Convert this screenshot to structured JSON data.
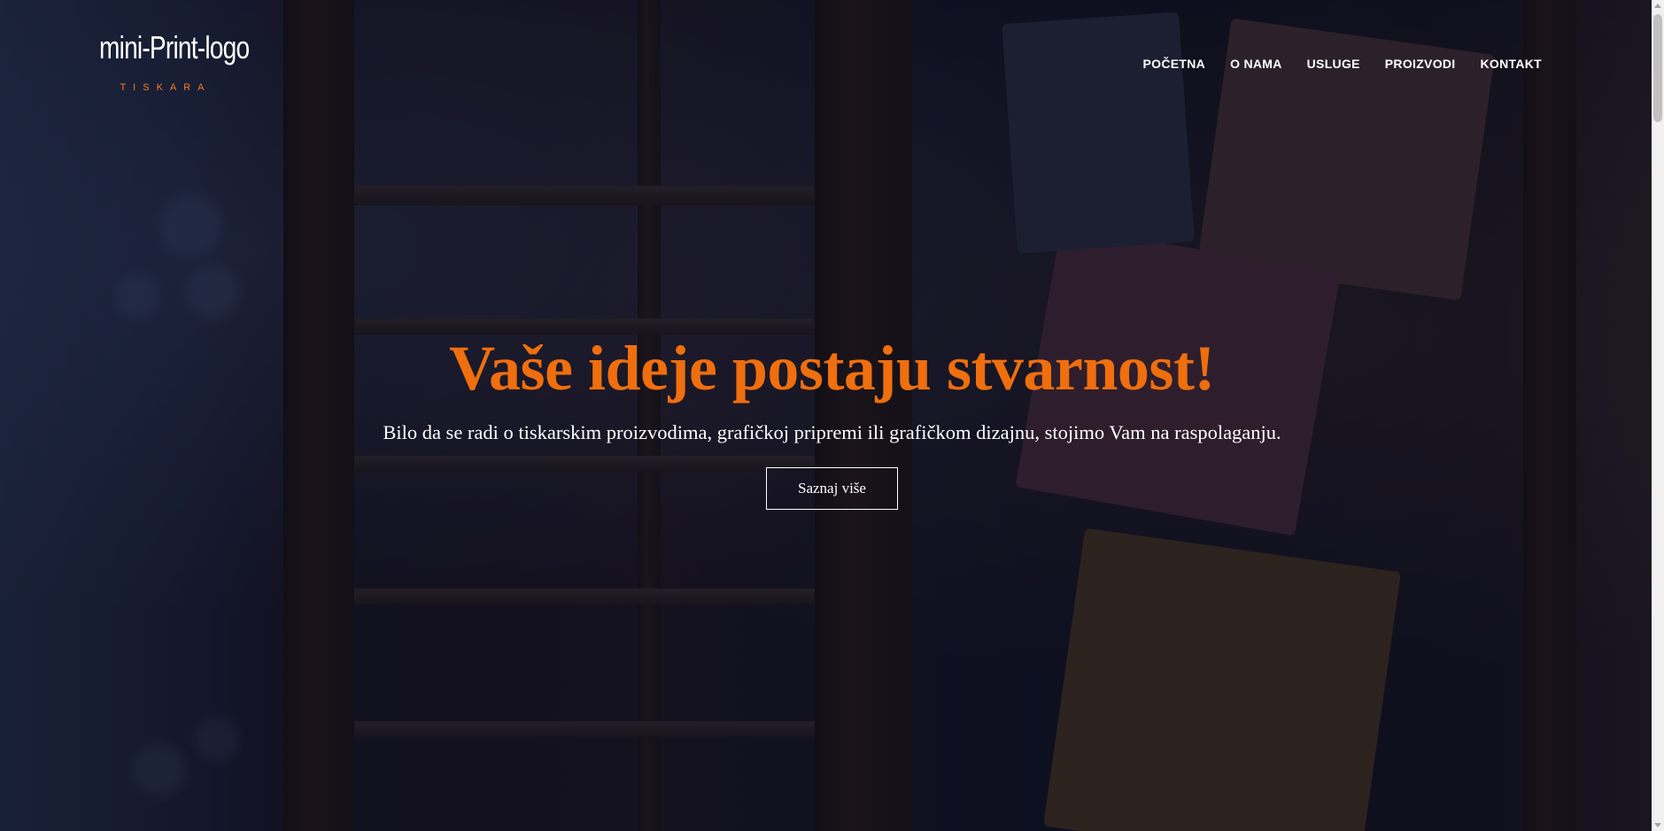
{
  "brand": {
    "logo_text": "mini-Print-logo",
    "logo_subtext": "TISKARA"
  },
  "nav": {
    "items": [
      {
        "label": "POČETNA"
      },
      {
        "label": "O NAMA"
      },
      {
        "label": "USLUGE"
      },
      {
        "label": "PROIZVODI"
      },
      {
        "label": "KONTAKT"
      }
    ]
  },
  "hero": {
    "headline": "Vaše ideje postaju stvarnost!",
    "subtitle": "Bilo da se radi o tiskarskim proizvodima, grafičkoj pripremi ili grafičkom dizajnu, stojimo Vam na raspolaganju.",
    "cta_label": "Saznaj više",
    "background_image": "letterpress-blocks-photo"
  },
  "colors": {
    "accent": "#ef6e0e",
    "text": "#ffffff",
    "overlay": "#0d1020"
  }
}
